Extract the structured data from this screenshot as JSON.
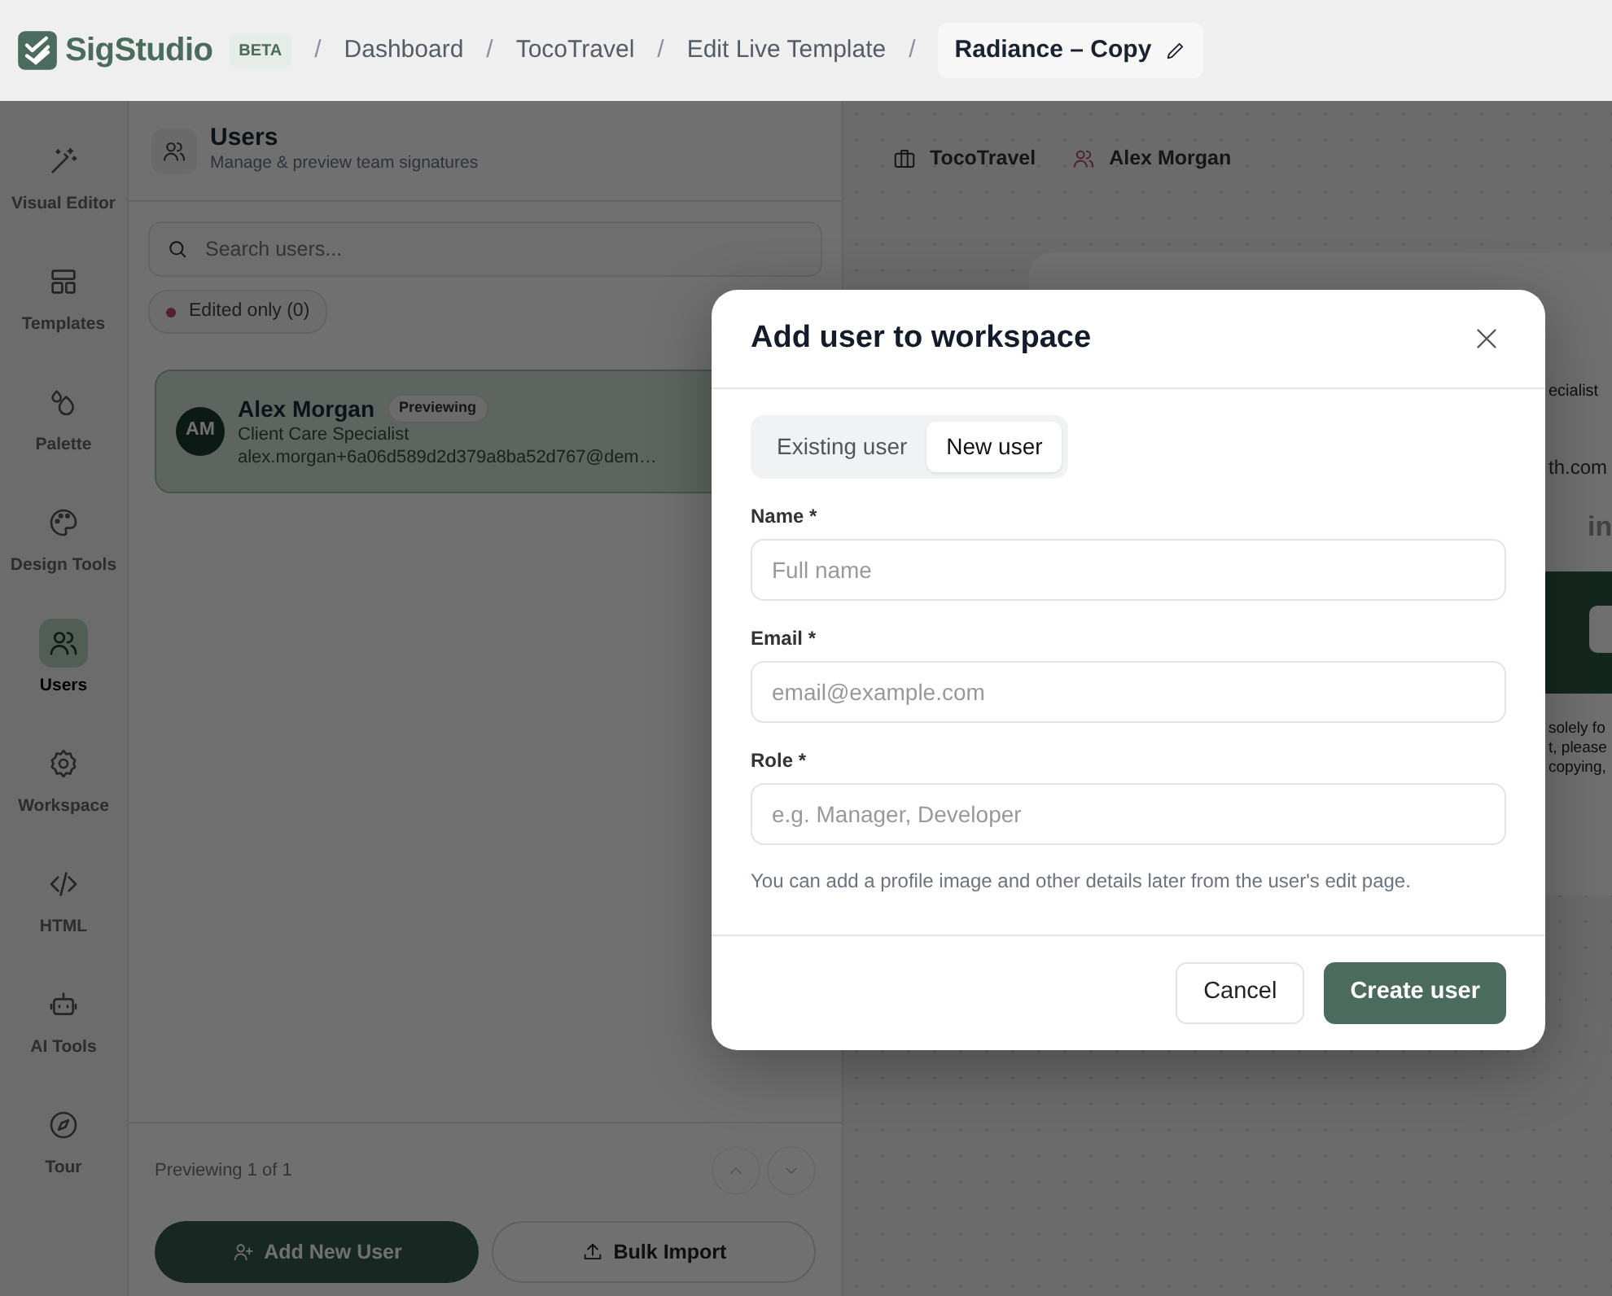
{
  "header": {
    "logo": "SigStudio",
    "badge": "BETA",
    "breadcrumbs": [
      {
        "label": "Dashboard",
        "separator": "/",
        "current": false
      },
      {
        "label": "TocoTravel",
        "separator": "/",
        "current": false
      },
      {
        "label": "Edit Live Template",
        "separator": "/",
        "current": false
      },
      {
        "label": "Radiance – Copy",
        "separator": "/",
        "current": true
      }
    ]
  },
  "sidebar": {
    "items": [
      {
        "label": "Visual Editor",
        "selected": false
      },
      {
        "label": "Templates",
        "selected": false
      },
      {
        "label": "Palette",
        "selected": false
      },
      {
        "label": "Design Tools",
        "selected": false
      },
      {
        "label": "Users",
        "selected": true
      },
      {
        "label": "Workspace",
        "selected": false
      },
      {
        "label": "HTML",
        "selected": false
      },
      {
        "label": "AI Tools",
        "selected": false
      },
      {
        "label": "Tour",
        "selected": false
      }
    ]
  },
  "users_panel": {
    "title": "Users",
    "subtitle": "Manage & preview team signatures",
    "search": {
      "placeholder": "Search users..."
    },
    "filter": {
      "label": "Edited only (0)"
    },
    "users": [
      {
        "initials": "AM",
        "name": "Alex Morgan",
        "badge": "Previewing",
        "role": "Client Care Specialist",
        "email": "alex.morgan+6a06d589d2d379a8ba52d767@dem…",
        "selected": true
      }
    ],
    "pager": "Previewing 1 of 1",
    "buttons": [
      {
        "label": "Add New User",
        "kind": "primary"
      },
      {
        "label": "Bulk Import",
        "kind": "outline"
      }
    ]
  },
  "preview": {
    "workspace": "TocoTravel",
    "user": "Alex Morgan",
    "card": {
      "role_fragment": "ecialist",
      "email_fragment": "th.com",
      "social": "in",
      "disclaimer_fragments": [
        "solely fo",
        "t, please",
        "copying,"
      ]
    }
  },
  "modal": {
    "title": "Add user to workspace",
    "tabs": [
      {
        "label": "Existing user",
        "selected": false
      },
      {
        "label": "New user",
        "selected": true
      }
    ],
    "fields": [
      {
        "label": "Name *",
        "placeholder": "Full name"
      },
      {
        "label": "Email *",
        "placeholder": "email@example.com"
      },
      {
        "label": "Role *",
        "placeholder": "e.g. Manager, Developer"
      }
    ],
    "help": "You can add a profile image and other details later from the user's edit page.",
    "buttons": [
      {
        "label": "Cancel",
        "kind": "secondary"
      },
      {
        "label": "Create user",
        "kind": "primary"
      }
    ]
  }
}
